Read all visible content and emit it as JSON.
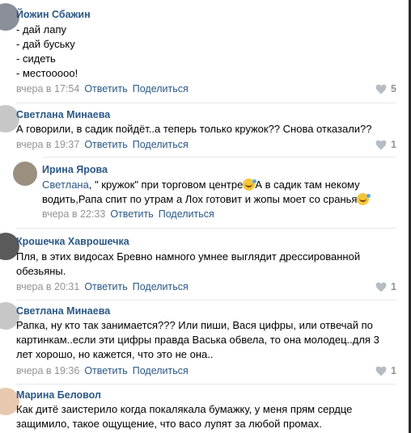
{
  "comments": [
    {
      "author": "Йожин Сбажин",
      "lines": [
        "- дай лапу",
        "- дай буську",
        "- сидеть",
        "- местооооо!"
      ],
      "time": "вчера в 17:54",
      "reply": "Ответить",
      "share": "Поделиться",
      "likes": "5",
      "avatar_color": "#8a8f98"
    },
    {
      "author": "Светлана Минаева",
      "lines": [
        "А говорили, в садик пойдёт..а теперь только кружок?? Снова отказали??"
      ],
      "time": "вчера в 19:37",
      "reply": "Ответить",
      "share": "Поделиться",
      "likes": "1",
      "avatar_color": "#c7c7c7"
    },
    {
      "author": "Ирина Ярова",
      "mention": "Светлана",
      "line1_rest": ", \" кружок\" при торговом центре",
      "line1_after": "А в садик там некому",
      "line2": "водить,Рапа спит по утрам а Лох готовит и жопы моет со сранья",
      "time": "вчера в 22:33",
      "reply": "Ответить",
      "share": "Поделиться",
      "avatar_color": "#9b8f80"
    },
    {
      "author": "Крошечка Хаврошечка",
      "lines": [
        "Пля, в этих видосах Бревно намного умнее выглядит дрессированной",
        "обезьяны."
      ],
      "time": "вчера в 20:31",
      "reply": "Ответить",
      "share": "Поделиться",
      "likes": "1",
      "avatar_color": "#5a5a5a"
    },
    {
      "author": "Светлана Минаева",
      "lines": [
        "Рапка, ну кто так занимается??? Или пиши, Вася цифры, или отвечай по",
        "картинкам..если эти цифры правда Васька обвела, то она молодец..для 3",
        "лет хорошо, но кажется, что это не она.."
      ],
      "time": "вчера в 19:36",
      "reply": "Ответить",
      "share": "Поделиться",
      "likes": "1",
      "avatar_color": "#c7c7c7"
    },
    {
      "author": "Марина Беловол",
      "lines": [
        "Как дитё заистерило когда покалякала бумажку, у меня прям сердце",
        "защимило, такое ощущение, что васо лупят за любой промах."
      ],
      "avatar_color": "#e8c9b0"
    }
  ],
  "icons": {
    "like": "heart-icon"
  },
  "colors": {
    "link": "#2a5885",
    "meta": "#939393",
    "separator": "#e7e8ec"
  }
}
